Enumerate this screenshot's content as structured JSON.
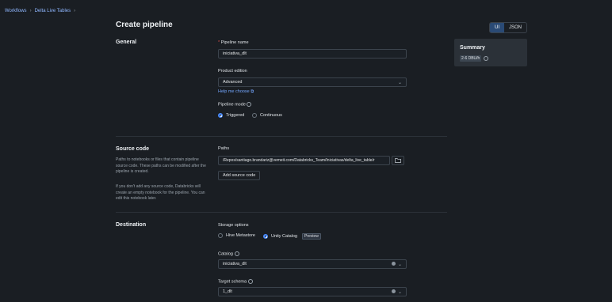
{
  "breadcrumb": {
    "items": [
      "Workflows",
      "Delta Live Tables"
    ]
  },
  "page": {
    "title": "Create pipeline"
  },
  "view_toggle": {
    "ui": "UI",
    "json": "JSON"
  },
  "summary": {
    "title": "Summary",
    "badge": "2-6 DBU/h"
  },
  "general": {
    "title": "General",
    "pipeline_name_label": "Pipeline name",
    "pipeline_name_value": "iniciativa_dlt",
    "product_edition_label": "Product edition",
    "product_edition_value": "Advanced",
    "help_link": "Help me choose",
    "pipeline_mode_label": "Pipeline mode",
    "mode_triggered": "Triggered",
    "mode_continuous": "Continuous"
  },
  "source": {
    "title": "Source code",
    "description1": "Paths to notebooks or files that contain pipeline source code. These paths can be modified after the pipeline is created.",
    "description2": "If you don't add any source code, Databricks will create an empty notebook for the pipeline. You can edit this notebook later.",
    "paths_label": "Paths",
    "path_value": "/Repos/santiago.brandariz@vemeit.com/Databricks_Team/Iniciativas/delta_live_table/r",
    "add_button": "Add source code"
  },
  "destination": {
    "title": "Destination",
    "storage_label": "Storage options",
    "hive": "Hive Metastore",
    "unity": "Unity Catalog",
    "preview": "Preview",
    "catalog_label": "Catalog",
    "catalog_value": "iniciativa_dlt",
    "schema_label": "Target schema",
    "schema_value": "1_dlt"
  }
}
